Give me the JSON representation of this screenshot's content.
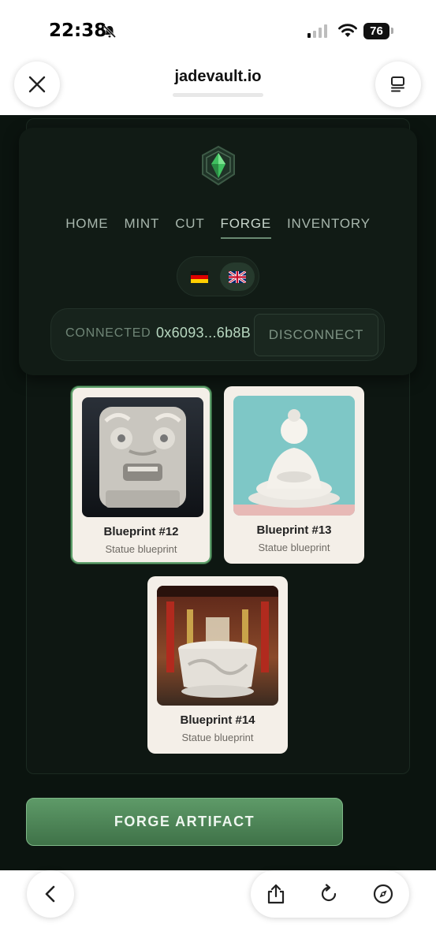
{
  "status": {
    "time": "22:38",
    "battery": "76"
  },
  "browser": {
    "url": "jadevault.io"
  },
  "nav": {
    "items": [
      {
        "label": "HOME",
        "active": false
      },
      {
        "label": "MINT",
        "active": false
      },
      {
        "label": "CUT",
        "active": false
      },
      {
        "label": "FORGE",
        "active": true
      },
      {
        "label": "INVENTORY",
        "active": false
      }
    ]
  },
  "language": {
    "options": [
      "de",
      "en-gb"
    ],
    "selected": "en-gb"
  },
  "wallet": {
    "status": "CONNECTED",
    "address": "0x6093...6b8B",
    "disconnect_label": "DISCONNECT"
  },
  "blueprints": [
    {
      "title": "Blueprint #12",
      "subtitle": "Statue blueprint",
      "selected": true
    },
    {
      "title": "Blueprint #13",
      "subtitle": "Statue blueprint",
      "selected": false
    },
    {
      "title": "Blueprint #14",
      "subtitle": "Statue blueprint",
      "selected": false
    }
  ],
  "actions": {
    "forge_label": "FORGE ARTIFACT"
  },
  "colors": {
    "accent": "#5e9a68",
    "background": "#0b140f",
    "card": "#f4efe8"
  }
}
